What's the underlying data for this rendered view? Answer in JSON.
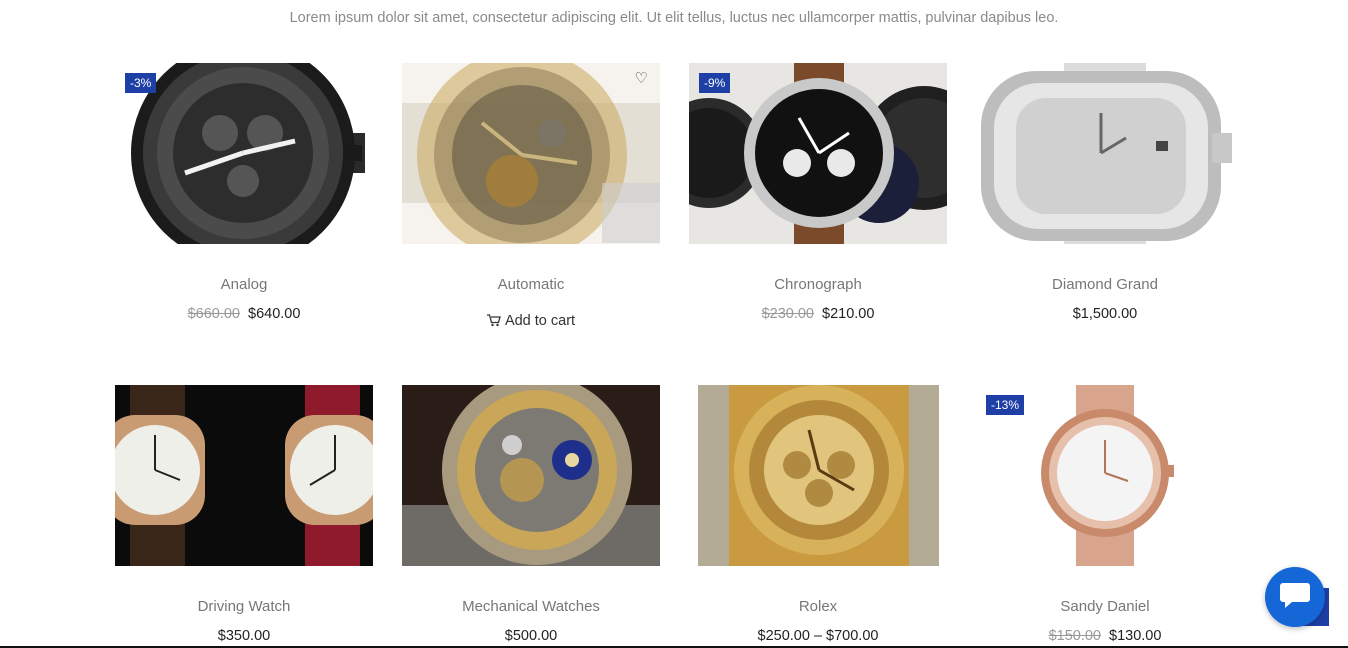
{
  "intro_text": "Lorem ipsum dolor sit amet, consectetur adipiscing elit. Ut elit tellus, luctus nec ullamcorper mattis, pulvinar dapibus leo.",
  "products": [
    {
      "title": "Analog",
      "badge": "-3%",
      "old_price": "$660.00",
      "price": "$640.00",
      "image": "dark-chronograph-watch"
    },
    {
      "title": "Automatic",
      "badge": "",
      "cart_label": "Add to cart",
      "image": "skeleton-gold-watch",
      "wishlist_icon": "heart-icon"
    },
    {
      "title": "Chronograph",
      "badge": "-9%",
      "old_price": "$230.00",
      "price": "$210.00",
      "image": "three-watches-collage"
    },
    {
      "title": "Diamond Grand",
      "badge": "",
      "price": "$1,500.00",
      "image": "diamond-square-watch"
    },
    {
      "title": "Driving Watch",
      "badge": "",
      "price": "$350.00",
      "image": "two-leather-watches"
    },
    {
      "title": "Mechanical Watches",
      "badge": "",
      "price": "$500.00",
      "image": "engraved-skeleton-watch"
    },
    {
      "title": "Rolex",
      "badge": "",
      "price": "$250.00 – $700.00",
      "image": "gold-diamond-watch"
    },
    {
      "title": "Sandy Daniel",
      "badge": "-13%",
      "old_price": "$150.00",
      "price": "$130.00",
      "image": "rose-gold-mesh-watch"
    }
  ],
  "chat_widget": {
    "icon": "chat-bubble-icon"
  },
  "colors": {
    "badge": "#1e3fa6",
    "chat": "#1566d6"
  }
}
